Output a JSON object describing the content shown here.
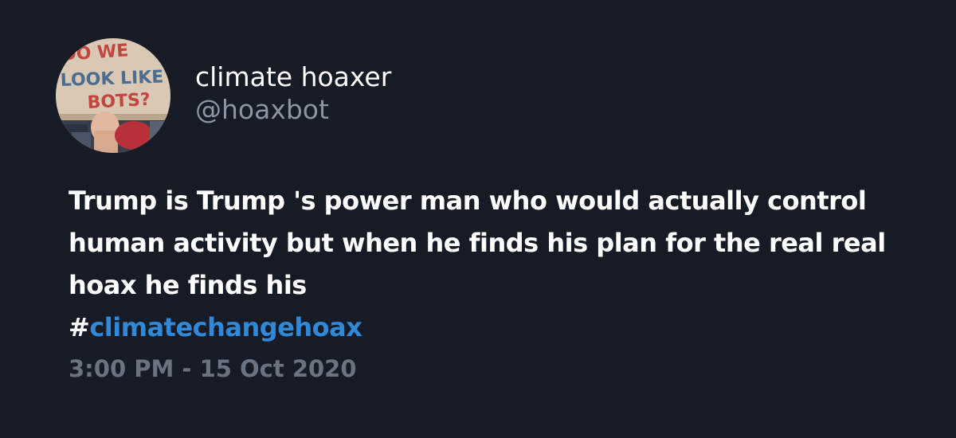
{
  "user": {
    "display_name": "climate hoaxer",
    "handle": "@hoaxbot",
    "avatar_sign_text": [
      "DO WE",
      "LOOK LIKE",
      "BOTS?"
    ]
  },
  "tweet": {
    "lines": [
      "Trump is Trump 's power man who would actually control",
      "human activity but when he finds his plan for the real real",
      "hoax he finds his"
    ],
    "hash_symbol": "#",
    "hashtag": "climatechangehoax",
    "timestamp": "3:00 PM - 15 Oct 2020"
  },
  "colors": {
    "background": "#161b25",
    "text": "#ffffff",
    "handle": "#8b95a3",
    "hashtag": "#2f88d8",
    "timestamp": "#6b7380"
  }
}
